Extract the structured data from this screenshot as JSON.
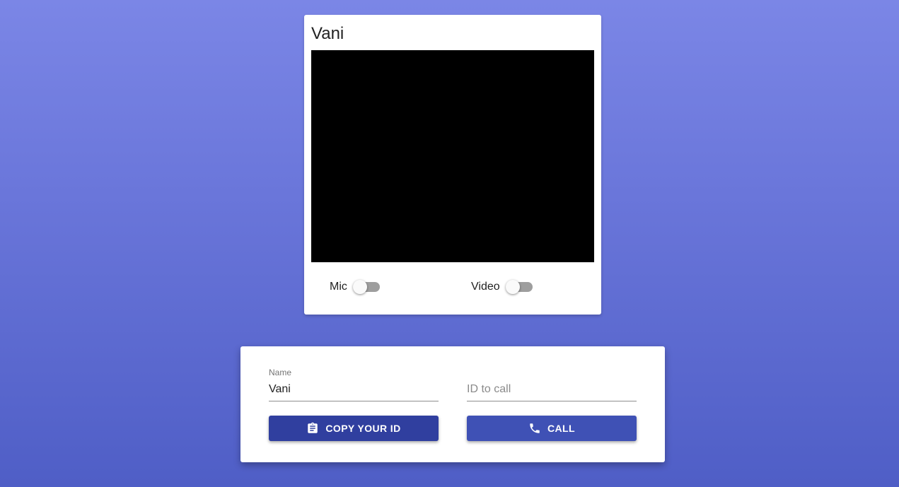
{
  "video_card": {
    "title": "Vani",
    "mic": {
      "label": "Mic",
      "on": false
    },
    "video": {
      "label": "Video",
      "on": false
    }
  },
  "form": {
    "name_field": {
      "label": "Name",
      "value": "Vani"
    },
    "id_field": {
      "placeholder": "ID to call",
      "value": ""
    },
    "copy_button": {
      "label": "COPY YOUR ID",
      "icon": "clipboard-icon"
    },
    "call_button": {
      "label": "CALL",
      "icon": "phone-icon"
    }
  },
  "colors": {
    "background_top": "#7b86e6",
    "background_bottom": "#4f5ec6",
    "copy_button": "#303f9f",
    "call_button": "#3f51b5",
    "switch_track_off": "#9e9e9e"
  }
}
